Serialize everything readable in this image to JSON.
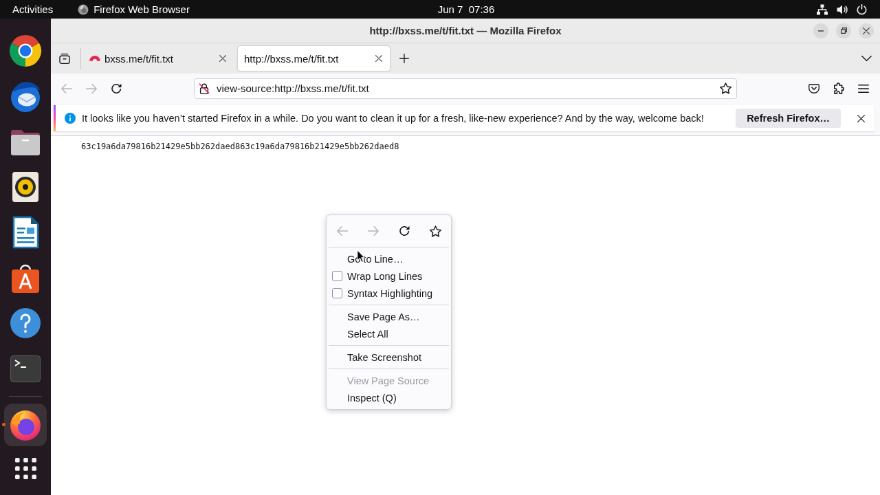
{
  "top_bar": {
    "activities": "Activities",
    "app_name": "Firefox Web Browser",
    "clock": "Jun 7  07:36"
  },
  "dock": {
    "favorites": [
      {
        "kind": "chrome",
        "running": false,
        "focused": false
      },
      {
        "kind": "thunderbird",
        "running": false,
        "focused": false
      },
      {
        "kind": "files",
        "running": false,
        "focused": false
      },
      {
        "kind": "rhythmbox",
        "running": false,
        "focused": false
      },
      {
        "kind": "writer",
        "running": false,
        "focused": false
      },
      {
        "kind": "app_center",
        "running": false,
        "focused": false
      },
      {
        "kind": "help",
        "running": false,
        "focused": false
      },
      {
        "kind": "terminal",
        "running": false,
        "focused": false
      }
    ],
    "others": [
      {
        "kind": "firefox",
        "running": true,
        "focused": true
      }
    ]
  },
  "window": {
    "title": "http://bxss.me/t/fit.txt — Mozilla Firefox"
  },
  "tabs": [
    {
      "label": "bxss.me/t/fit.txt",
      "selected": false,
      "favicon": true
    },
    {
      "label": "http://bxss.me/t/fit.txt",
      "selected": true,
      "favicon": false
    }
  ],
  "navigation": {
    "back": {
      "disabled": true
    },
    "forward": {
      "disabled": true
    }
  },
  "address_bar": {
    "value": "view-source:http://bxss.me/t/fit.txt"
  },
  "notification": {
    "message": "It looks like you haven’t started Firefox in a while. Do you want to clean it up for a fresh, like-new experience? And by the way, welcome back!",
    "button": "Refresh Firefox…"
  },
  "page": {
    "lines": [
      "63c19a6da79816b21429e5bb262daed863c19a6da79816b21429e5bb262daed8"
    ]
  },
  "context_menu": {
    "navigation": {
      "back": {
        "disabled": true
      },
      "forward": {
        "disabled": true
      }
    },
    "items": [
      {
        "kind": "item",
        "label": "Go to Line…",
        "disabled": false
      },
      {
        "kind": "checkbox",
        "label": "Wrap Long Lines",
        "checked": false,
        "disabled": false
      },
      {
        "kind": "checkbox",
        "label": "Syntax Highlighting",
        "checked": false,
        "disabled": false
      },
      {
        "kind": "separator"
      },
      {
        "kind": "item",
        "label": "Save Page As…",
        "disabled": false
      },
      {
        "kind": "item",
        "label": "Select All",
        "disabled": false
      },
      {
        "kind": "separator"
      },
      {
        "kind": "item",
        "label": "Take Screenshot",
        "disabled": false
      },
      {
        "kind": "separator"
      },
      {
        "kind": "item",
        "label": "View Page Source",
        "disabled": true
      },
      {
        "kind": "item",
        "label": "Inspect (Q)",
        "disabled": false
      }
    ]
  }
}
